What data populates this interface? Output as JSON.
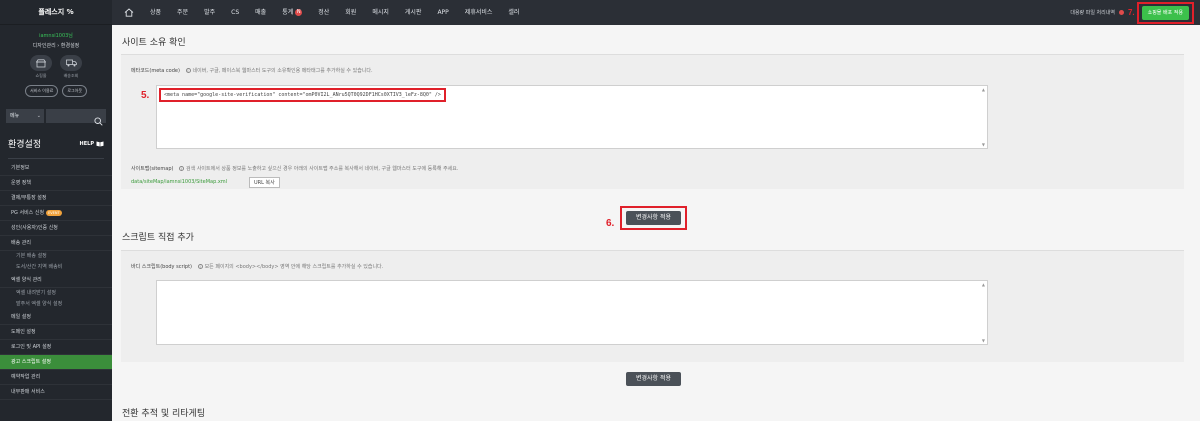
{
  "sidebar": {
    "logo": "플레스지 %",
    "user_name": "iamnsi1003님",
    "breadcrumb": "디자인관리 › 환경설정",
    "shortcuts": [
      {
        "label": "쇼핑몰",
        "icon": "store-icon"
      },
      {
        "label": "배송조회",
        "icon": "truck-icon"
      }
    ],
    "pills": [
      "서비스 이용료",
      "로그아웃"
    ],
    "search_select": "메뉴",
    "settings_title": "환경설정",
    "help_label": "HELP",
    "menu": [
      {
        "label": "기본정보",
        "type": "main"
      },
      {
        "label": "운영 정책",
        "type": "main"
      },
      {
        "label": "결제/무통장 설정",
        "type": "main"
      },
      {
        "label": "PG 서비스 신청",
        "type": "main",
        "badge": "EVENT"
      },
      {
        "label": "성인(사용자)인증 신청",
        "type": "main"
      },
      {
        "label": "배송 관리",
        "type": "main"
      },
      {
        "label": "기본 배송 설정",
        "type": "sub"
      },
      {
        "label": "도서/산간 지역 배송비",
        "type": "sub"
      },
      {
        "label": "엑셀 양식 관리",
        "type": "main"
      },
      {
        "label": "엑셀 내려받기 설정",
        "type": "sub"
      },
      {
        "label": "발주서 엑셀 양식 설정",
        "type": "sub"
      },
      {
        "label": "메일 설정",
        "type": "main"
      },
      {
        "label": "도메인 설정",
        "type": "main"
      },
      {
        "label": "로그인 및 API 설정",
        "type": "main"
      },
      {
        "label": "광고 스크립트 설정",
        "type": "main",
        "active": true
      },
      {
        "label": "예약작업 관리",
        "type": "main"
      },
      {
        "label": "내부판매 서비스",
        "type": "main"
      }
    ]
  },
  "topnav": {
    "items": [
      "상품",
      "주문",
      "발주",
      "CS",
      "매출",
      "통계",
      "정산",
      "회원",
      "메시지",
      "게시판",
      "APP",
      "제휴서비스",
      "셀러"
    ],
    "badge_item_index": 5,
    "badge_value": "N",
    "pending_label": "대용량 파일 처리내역",
    "step7": "7.",
    "shop_button": "쇼핑몰 배포 적용"
  },
  "site_ownership": {
    "title": "사이트 소유 확인",
    "meta_label": "메타코드(meta code)",
    "meta_hint": "네이버, 구글, 페이스북 웹마스터 도구의 소유확인용 메타태그를 추가하실 수 있습니다.",
    "meta_code": "<meta name=\"google-site-verification\" content=\"omP0VI2L_ANru5QT0Q92DF1HCs0XTIV3_leFz-8Q0\" />",
    "step5": "5.",
    "sitemap_label": "사이트맵(sitemap)",
    "sitemap_hint": "검색 사이트에서 상품 정보를 노출하고 싶으신 경우 아래의 사이트맵 주소를 복사해서 네이버, 구글 웹마스터 도구에 등록해 주세요.",
    "sitemap_url": "data/siteMap/iamnsi1003/SiteMap.xml",
    "url_copy": "URL 복사",
    "step6": "6.",
    "apply_button": "변경사항 적용"
  },
  "script_section": {
    "title": "스크립트 직접 추가",
    "body_label": "바디 스크립트(body script)",
    "body_hint": "모든 페이지의 <body></body> 영역 안에 해당 스크립트를 추가하실 수 있습니다.",
    "apply_button": "변경사항 적용"
  },
  "conversion": {
    "title": "전환 추적 및 리타게팅"
  },
  "colors": {
    "accent_green": "#3cc04b",
    "highlight_red": "#e0202a",
    "sidebar_bg": "#23272d",
    "topbar_bg": "#2b2f36"
  }
}
